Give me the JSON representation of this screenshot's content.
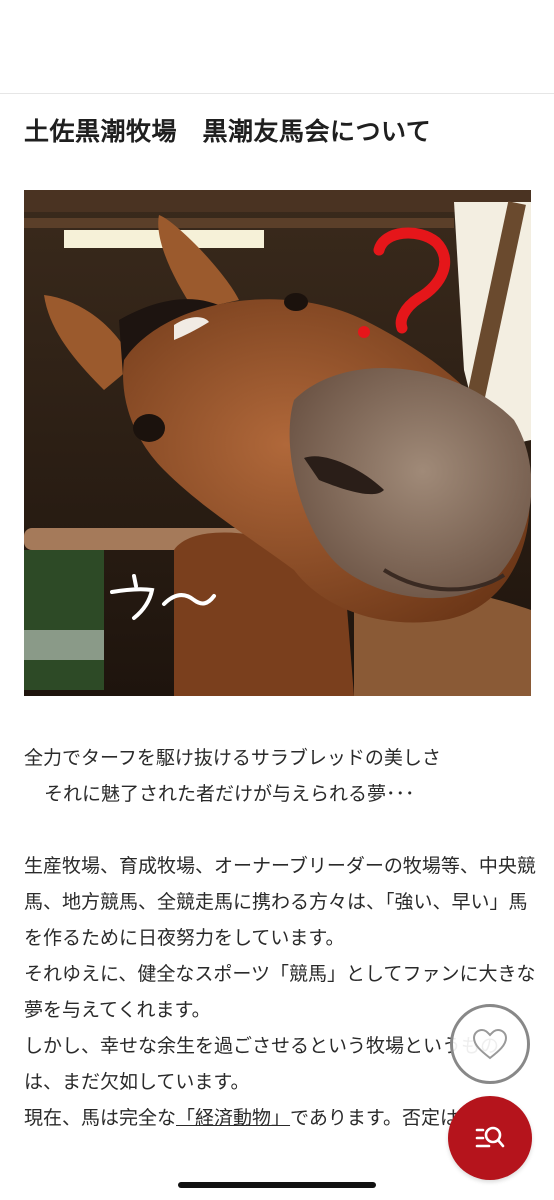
{
  "page": {
    "title": "土佐黒潮牧場　黒潮友馬会について"
  },
  "photo": {
    "overlay_question": "?",
    "overlay_caption": "ウ〜"
  },
  "article": {
    "line1": "全力でターフを駆け抜けるサラブレッドの美しさ",
    "line2": "それに魅了された者だけが与えられる夢･･･",
    "p1": "生産牧場、育成牧場、オーナーブリーダーの牧場等、中央競馬、地方競馬、全競走馬に携わる方々は、「強い、早い」馬を作るために日夜努力をしています。",
    "p2": "それゆえに、健全なスポーツ「競馬」としてファンに大きな夢を与えてくれます。",
    "p3": "しかし、幸せな余生を過ごさせるという牧場というものは、まだ欠如しています。",
    "p4_before": "現在、馬は完全な",
    "p4_underlined": "「経済動物」",
    "p4_after": "であります。否定は出来ま"
  },
  "fab": {
    "favorite_icon": "heart-icon",
    "search_icon": "search-list-icon",
    "accent": "#b5141c"
  }
}
